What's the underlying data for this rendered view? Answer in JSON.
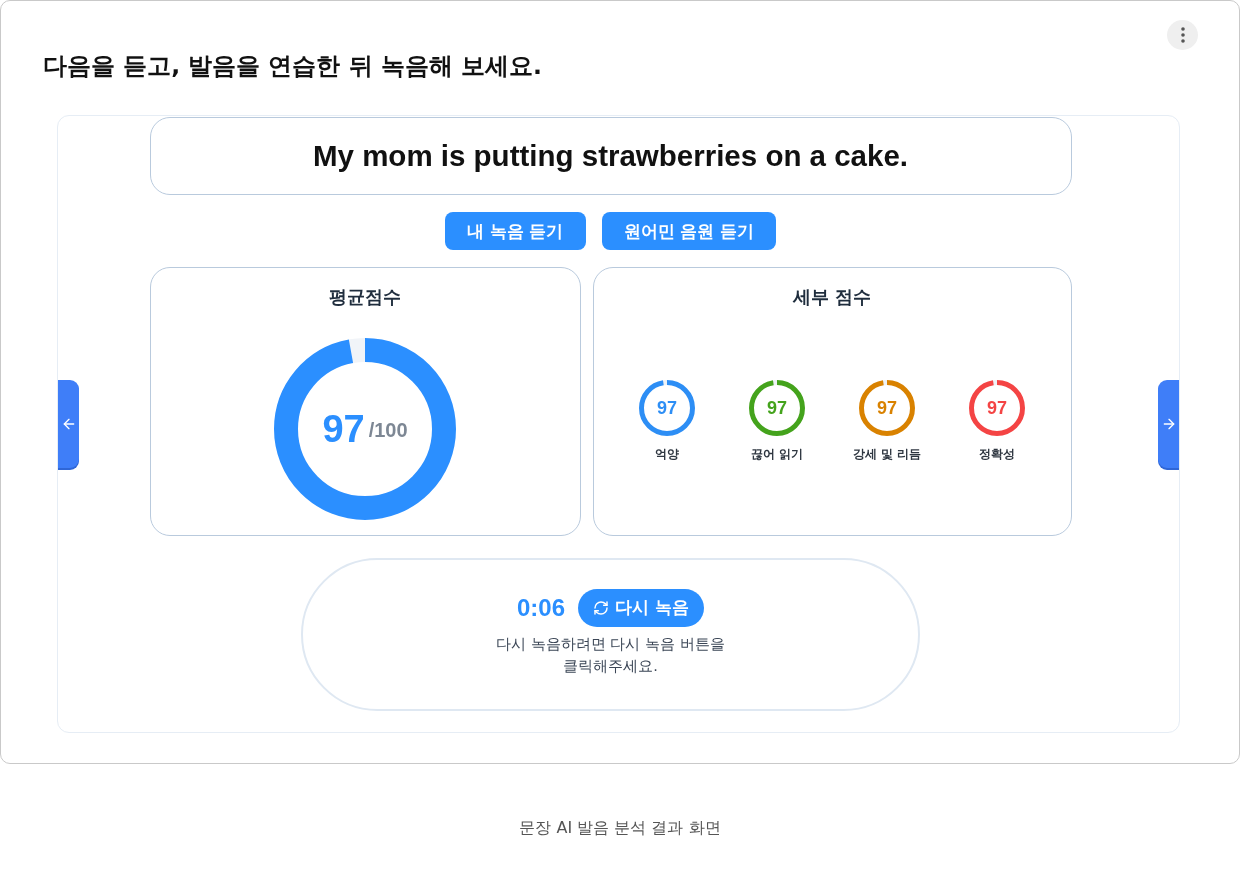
{
  "instruction": "다음을 듣고, 발음을 연습한 뒤 녹음해 보세요.",
  "sentence": "My mom is putting strawberries on a cake.",
  "playback_buttons": [
    "내 녹음 듣기",
    "원어민 음원 듣기"
  ],
  "average_score": {
    "title": "평균점수",
    "score": "97",
    "max": "/100",
    "level": 0.97
  },
  "detail_scores": {
    "title": "세부 점수",
    "items": [
      {
        "score": "97",
        "label": "억양",
        "color": "#2d8ef5",
        "level": 0.97
      },
      {
        "score": "97",
        "label": "끊어 읽기",
        "color": "#44a31c",
        "level": 0.97
      },
      {
        "score": "97",
        "label": "강세 및 리듬",
        "color": "#d98200",
        "level": 0.97
      },
      {
        "score": "97",
        "label": "정확성",
        "color": "#f44444",
        "level": 0.97
      }
    ]
  },
  "recording": {
    "time": "0:06",
    "retry_button": "다시 녹음",
    "hint": "다시 녹음하려면 다시 녹음 버튼을\n클릭해주세요."
  },
  "caption": "문장 AI 발음 분석 결과 화면"
}
